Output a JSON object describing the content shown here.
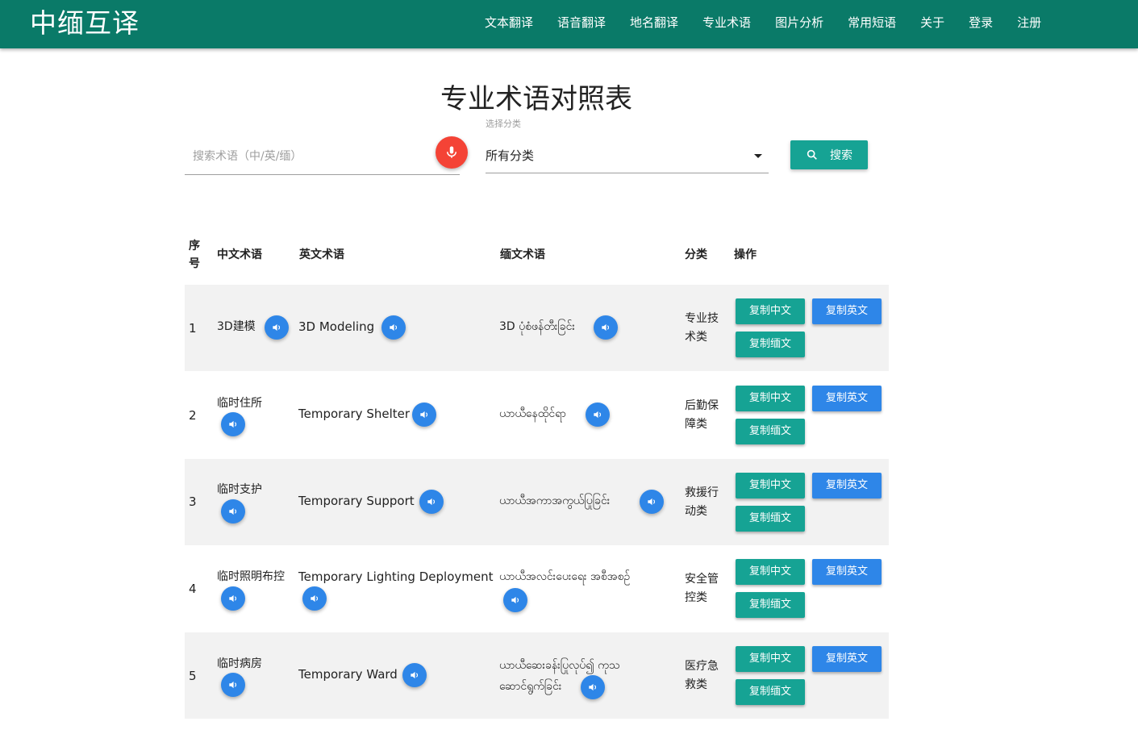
{
  "app": {
    "brand": "中缅互译"
  },
  "nav": [
    {
      "label": "文本翻译"
    },
    {
      "label": "语音翻译"
    },
    {
      "label": "地名翻译"
    },
    {
      "label": "专业术语"
    },
    {
      "label": "图片分析"
    },
    {
      "label": "常用短语"
    },
    {
      "label": "关于"
    },
    {
      "label": "登录"
    },
    {
      "label": "注册"
    }
  ],
  "page": {
    "title": "专业术语对照表"
  },
  "search": {
    "placeholder": "搜索术语（中/英/缅）",
    "value": ""
  },
  "category_select": {
    "label": "选择分类",
    "selected": "所有分类"
  },
  "search_button": {
    "label": "搜索"
  },
  "table": {
    "headers": {
      "index": "序号",
      "chinese": "中文术语",
      "english": "英文术语",
      "burmese": "缅文术语",
      "category": "分类",
      "actions": "操作"
    },
    "copy_labels": {
      "zh": "复制中文",
      "en": "复制英文",
      "my": "复制缅文"
    },
    "rows": [
      {
        "index": "1",
        "zh": "3D建模",
        "en": "3D Modeling",
        "my": "3D ပုံစံဖန်တီးခြင်း",
        "category": "专业技术类"
      },
      {
        "index": "2",
        "zh": "临时住所",
        "en": "Temporary Shelter",
        "my": "ယာယီနေထိုင်ရာ",
        "category": "后勤保障类"
      },
      {
        "index": "3",
        "zh": "临时支护",
        "en": "Temporary Support",
        "my": "ယာယီအကာအကွယ်ပြုခြင်း",
        "category": "救援行动类"
      },
      {
        "index": "4",
        "zh": "临时照明布控",
        "en": "Temporary Lighting Deployment",
        "my": "ယာယီအလင်းပေးရေး အစီအစဉ်",
        "category": "安全管控类"
      },
      {
        "index": "5",
        "zh": "临时病房",
        "en": "Temporary Ward",
        "my": "ယာယီဆေးခန်းပြုလုပ်၍ ကုသဆောင်ရွက်ခြင်း",
        "category": "医疗急救类"
      }
    ]
  },
  "colors": {
    "header": "#0a7a68",
    "teal_button": "#16a394",
    "blue_button": "#2e86e8",
    "mic": "#f44336",
    "row_shade": "#f2f2f2"
  },
  "icons": {
    "mic": "microphone-icon",
    "search": "search-icon",
    "play": "speaker-icon",
    "caret": "caret-down-icon"
  }
}
